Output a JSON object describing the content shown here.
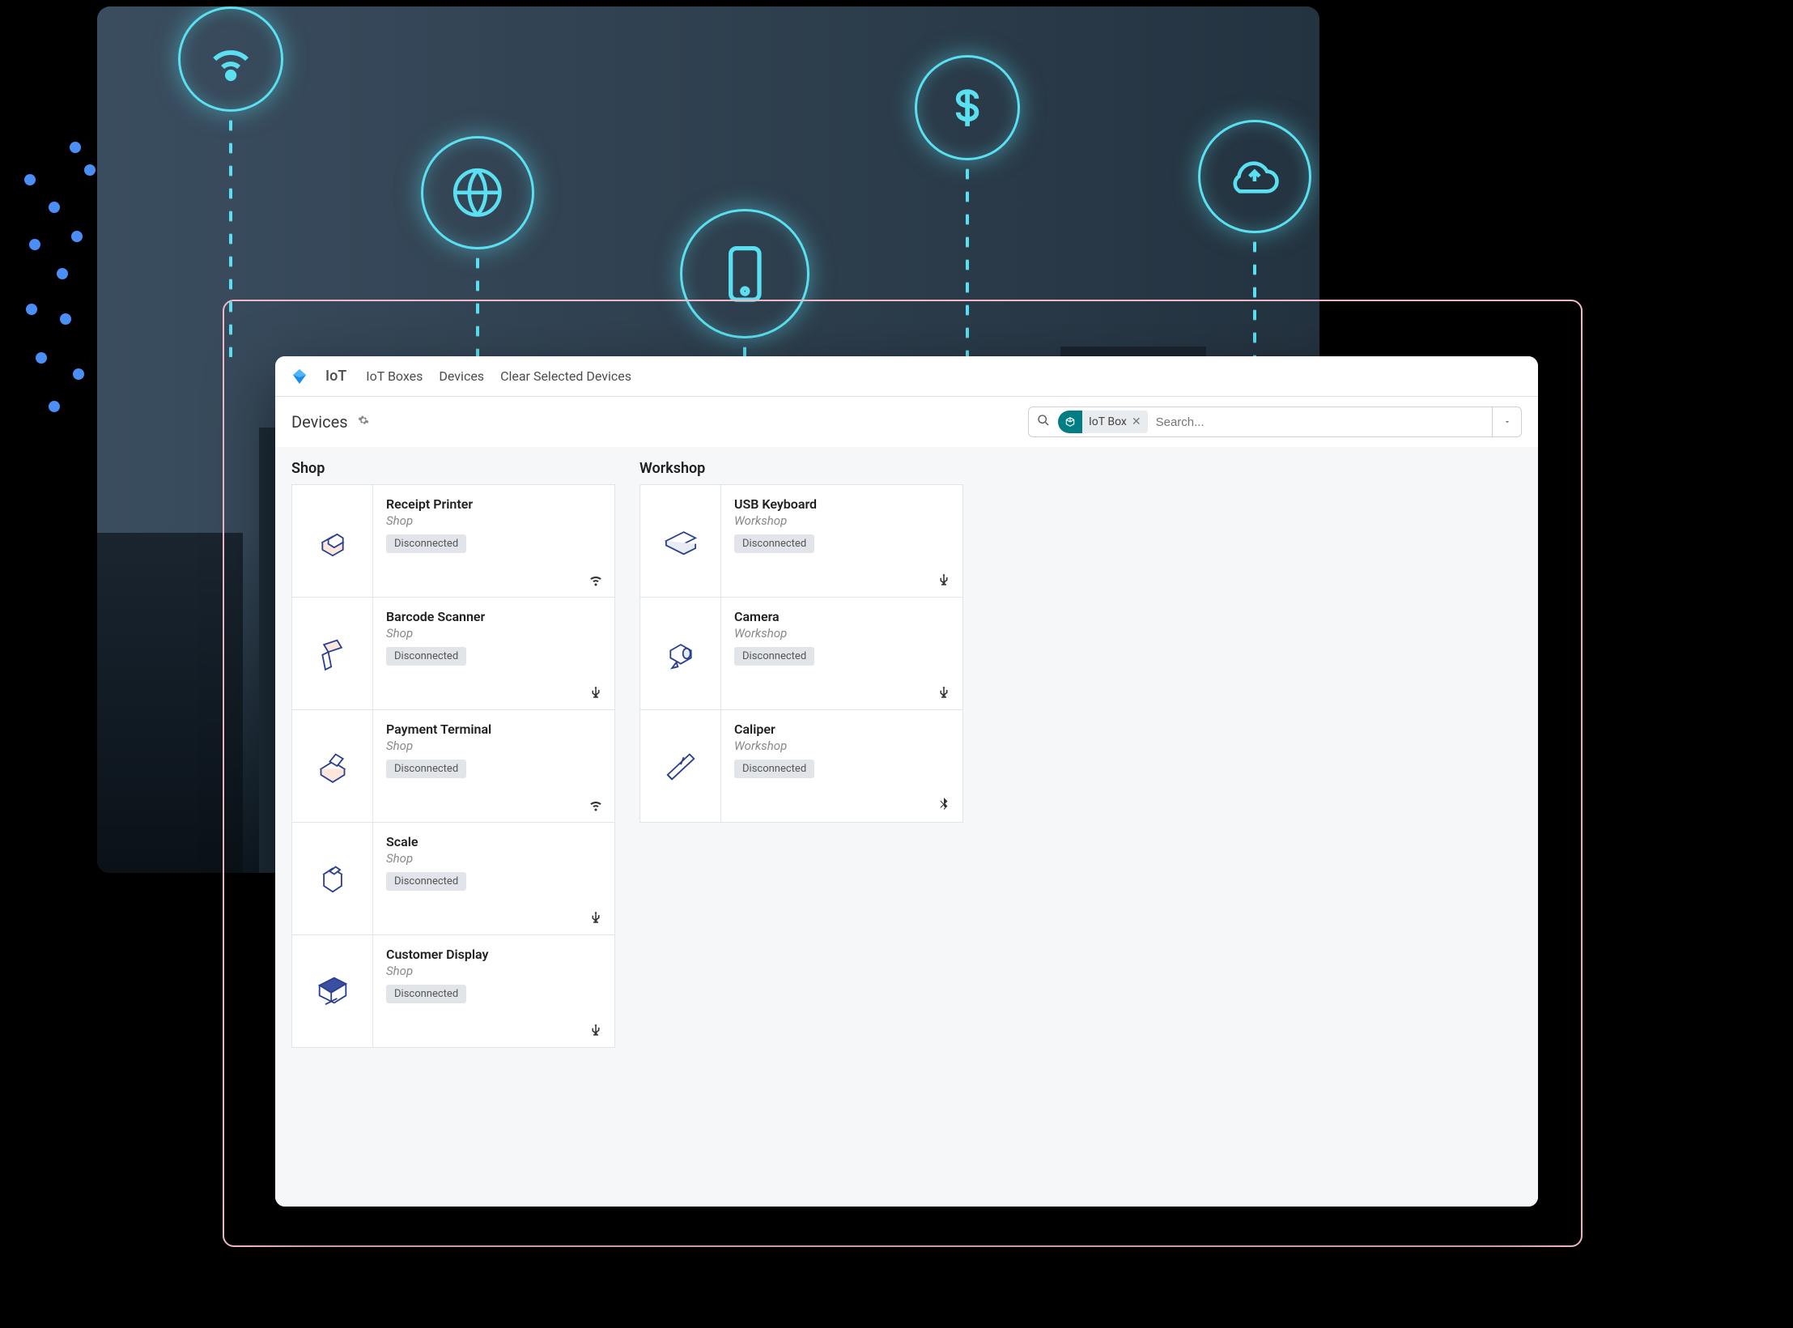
{
  "topbar": {
    "app_name": "IoT",
    "nav": [
      "IoT Boxes",
      "Devices",
      "Clear Selected Devices"
    ]
  },
  "subbar": {
    "title": "Devices",
    "filter_chip": "IoT Box",
    "search_placeholder": "Search..."
  },
  "columns": [
    {
      "title": "Shop",
      "devices": [
        {
          "name": "Receipt Printer",
          "location": "Shop",
          "status": "Disconnected",
          "conn": "wifi",
          "icon": "printer"
        },
        {
          "name": "Barcode Scanner",
          "location": "Shop",
          "status": "Disconnected",
          "conn": "usb",
          "icon": "scanner"
        },
        {
          "name": "Payment Terminal",
          "location": "Shop",
          "status": "Disconnected",
          "conn": "wifi",
          "icon": "terminal"
        },
        {
          "name": "Scale",
          "location": "Shop",
          "status": "Disconnected",
          "conn": "usb",
          "icon": "scale"
        },
        {
          "name": "Customer Display",
          "location": "Shop",
          "status": "Disconnected",
          "conn": "usb",
          "icon": "display"
        }
      ]
    },
    {
      "title": "Workshop",
      "devices": [
        {
          "name": "USB Keyboard",
          "location": "Workshop",
          "status": "Disconnected",
          "conn": "usb",
          "icon": "keyboard"
        },
        {
          "name": "Camera",
          "location": "Workshop",
          "status": "Disconnected",
          "conn": "usb",
          "icon": "camera"
        },
        {
          "name": "Caliper",
          "location": "Workshop",
          "status": "Disconnected",
          "conn": "bluetooth",
          "icon": "caliper"
        }
      ]
    }
  ]
}
